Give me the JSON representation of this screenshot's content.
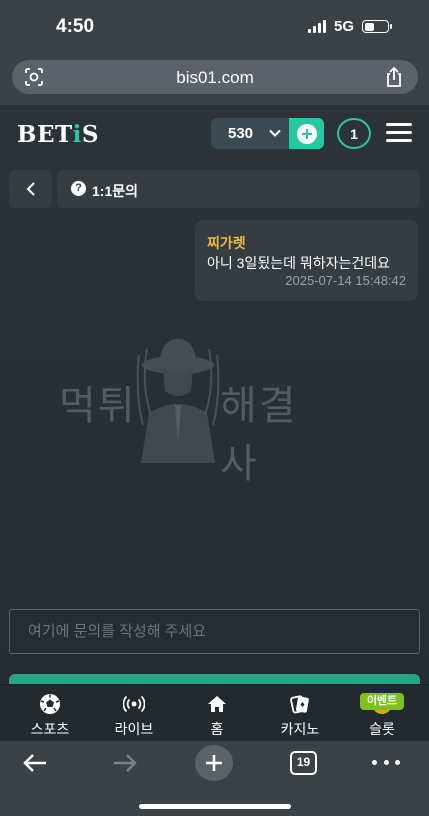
{
  "status_bar": {
    "time": "4:50",
    "network": "5G"
  },
  "browser": {
    "url": "bis01.com",
    "tab_count": "19"
  },
  "header": {
    "logo": {
      "prefix": "BET",
      "accent": "i",
      "suffix": "S"
    },
    "balance": "530",
    "notifications": "1"
  },
  "page": {
    "title": "1:1문의",
    "help_glyph": "?"
  },
  "message": {
    "author": "찌가렛",
    "body": "아니 3일됬는데 뭐하자는건데요",
    "timestamp": "2025-07-14 15:48:42"
  },
  "watermark": {
    "left_text": "먹튀",
    "right_text": "해결사"
  },
  "inquiry": {
    "placeholder": "여기에 문의를 작성해 주세요"
  },
  "bottom_nav": {
    "items": [
      {
        "label": "스포츠",
        "icon": "soccer-ball-icon"
      },
      {
        "label": "라이브",
        "icon": "live-broadcast-icon"
      },
      {
        "label": "홈",
        "icon": "home-icon"
      },
      {
        "label": "카지노",
        "icon": "cards-icon"
      },
      {
        "label": "슬롯",
        "icon": "slot-icon"
      }
    ],
    "event_badge": "이벤트"
  },
  "colors": {
    "accent": "#27c7a1",
    "author": "#f0b640",
    "event": "#7bc21a",
    "background": "#2b3238"
  }
}
